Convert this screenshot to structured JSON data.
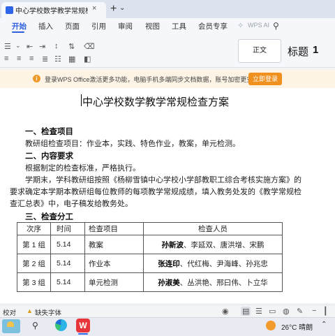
{
  "tab": {
    "title": "中心学校数学教学常规检查方案",
    "close": "×",
    "new": "+",
    "dropdown": "⌄"
  },
  "menu": {
    "items": [
      "开始",
      "插入",
      "页面",
      "引用",
      "审阅",
      "视图",
      "工具",
      "会员专享"
    ],
    "wps_ai": "WPS AI"
  },
  "ribbon": {
    "style_normal": "正文",
    "style_heading": "标题",
    "style_heading_num": "1"
  },
  "notice": {
    "text": "登录WPS Office激活更多功能，电脑手机多端同步文档数据，账号加密更安全。",
    "button": "立即登录"
  },
  "document": {
    "title": "中心学校数学教学常规检查方案",
    "sections": [
      {
        "heading": "一、检查项目",
        "body": [
          "教研组检查项目：作业本，实践、特色作业，教案，单元检测。"
        ]
      },
      {
        "heading": "二、内容要求",
        "body": [
          "根据制定的检查标准，严格执行。",
          "学期末，学科教研组按照《杨柳雪镇中心学校小学部教职工综合考核实施方案》的",
          "要求确定本学期本教研组每位教师的每项教学常规成绩，填入教务处发的《教学常规检",
          "查汇总表》中，电子稿发给教务处。"
        ]
      },
      {
        "heading": "三、检查分工",
        "body": []
      }
    ],
    "table": {
      "headers": [
        "次序",
        "时间",
        "检查项目",
        "检查人员"
      ],
      "rows": [
        {
          "group": "第 1 组",
          "date": "5.14",
          "item": "教案",
          "lead": "孙新波",
          "others": "、李延双、唐洪增、宋鹏"
        },
        {
          "group": "第 2 组",
          "date": "5.14",
          "item": "作业本",
          "lead": "张连印",
          "others": "、代红梅、尹海峰、孙兆忠"
        },
        {
          "group": "第 3 组",
          "date": "5.14",
          "item": "单元检测",
          "lead": "孙淑美",
          "others": "、丛洪艳、邢曰伟、卜立华"
        }
      ]
    }
  },
  "status": {
    "proof": "校对",
    "missing_font": "缺失字体"
  },
  "taskbar": {
    "weather": "26°C 晴朗"
  },
  "icons": [
    "search-icon",
    "close-icon",
    "plus-icon",
    "eye-icon",
    "page-view-icon",
    "list-icon",
    "globe-icon",
    "pencil-icon",
    "edge-icon",
    "wps-icon",
    "weather-icon"
  ]
}
